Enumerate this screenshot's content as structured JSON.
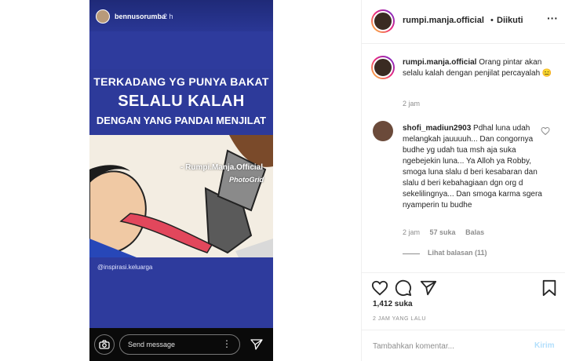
{
  "story": {
    "username": "bennusorumba",
    "time": "2 h",
    "meme": {
      "line1": "TERKADANG YG PUNYA BAKAT",
      "line2": "SELALU KALAH",
      "line3": "DENGAN YANG PANDAI MENJILAT",
      "watermark": "- Rumpi.Manja.Official",
      "app_mark": "PhotoGrid",
      "credit": "@inspirasi.keluarga"
    },
    "message_placeholder": "Send message",
    "colors": {
      "background": "#2e3b9d",
      "bar": "#0a0a0a"
    }
  },
  "post": {
    "header": {
      "username": "rumpi.manja.official",
      "separator": "•",
      "follow_status": "Diikuti",
      "more_icon": "ellipsis-icon"
    },
    "caption": {
      "username": "rumpi.manja.official",
      "text": "Orang pintar akan selalu kalah dengan penjilat percayalah 😑",
      "time": "2 jam"
    },
    "comment": {
      "username": "shofi_madiun2903",
      "text": "Pdhal luna udah melangkah jauuuuh... Dan congornya budhe yg udah tua msh aja suka ngebejekin luna... Ya Alloh ya Robby, smoga luna slalu d beri kesabaran dan slalu d beri kebahagiaan dgn org d sekelilingnya... Dan smoga karma sgera nyamperin tu budhe",
      "time": "2 jam",
      "likes": "57 suka",
      "reply": "Balas",
      "view_replies": "Lihat balasan (11)"
    },
    "actions": {
      "likes": "1,412 suka",
      "posted": "2 JAM YANG LALU"
    },
    "add_comment": {
      "placeholder": "Tambahkan komentar...",
      "submit": "Kirim"
    },
    "colors": {
      "text": "#262626",
      "muted": "#8e8e8e",
      "link_disabled": "#b2dffc"
    }
  }
}
